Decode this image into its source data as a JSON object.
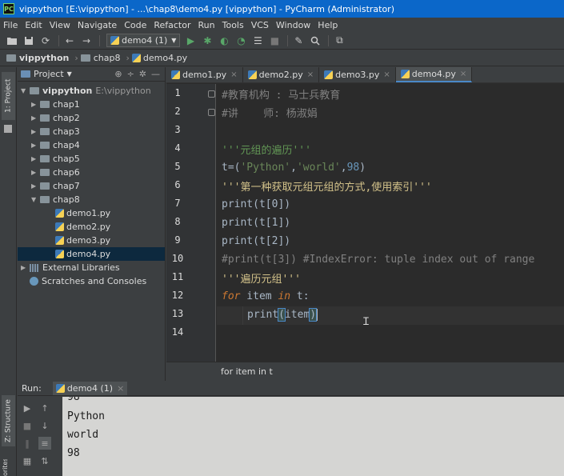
{
  "window": {
    "title": "vippython [E:\\vippython] - ...\\chap8\\demo4.py [vippython] - PyCharm (Administrator)",
    "app_icon_label": "PC"
  },
  "menu": [
    "File",
    "Edit",
    "View",
    "Navigate",
    "Code",
    "Refactor",
    "Run",
    "Tools",
    "VCS",
    "Window",
    "Help"
  ],
  "toolbar": {
    "run_config": "demo4 (1)"
  },
  "breadcrumb": [
    "vippython",
    "chap8",
    "demo4.py"
  ],
  "project_panel": {
    "header": "Project",
    "root": {
      "name": "vippython",
      "path": "E:\\vippython"
    },
    "folders": [
      "chap1",
      "chap2",
      "chap3",
      "chap4",
      "chap5",
      "chap6",
      "chap7",
      "chap8"
    ],
    "files": [
      "demo1.py",
      "demo2.py",
      "demo3.py",
      "demo4.py"
    ],
    "selected_file": "demo4.py",
    "external_libraries": "External Libraries",
    "scratches": "Scratches and Consoles",
    "side_tab": "1: Project"
  },
  "editor": {
    "tabs": [
      {
        "label": "demo1.py",
        "active": false
      },
      {
        "label": "demo2.py",
        "active": false
      },
      {
        "label": "demo3.py",
        "active": false
      },
      {
        "label": "demo4.py",
        "active": true
      }
    ],
    "line_numbers": [
      "1",
      "2",
      "3",
      "4",
      "5",
      "6",
      "7",
      "8",
      "9",
      "10",
      "11",
      "12",
      "13",
      "14"
    ],
    "code": {
      "l1": "#教育机构 : 马士兵教育",
      "l2": "#讲    师: 杨淑娟",
      "l4": "'''元组的遍历'''",
      "l5_a": "t=(",
      "l5_s1": "'Python'",
      "l5_c": ",",
      "l5_s2": "'world'",
      "l5_c2": ",",
      "l5_n": "98",
      "l5_b": ")",
      "l6": "'''第一种获取元组元组的方式,使用索引'''",
      "l7": "print(t[0])",
      "l8": "print(t[1])",
      "l9": "print(t[2])",
      "l10": "#print(t[3]) #IndexError: tuple index out of range",
      "l11": "'''遍历元组'''",
      "l12_kw1": "for",
      "l12_mid": " item ",
      "l12_kw2": "in",
      "l12_end": " t:",
      "l13_fn": "print",
      "l13_open": "(",
      "l13_arg": "item",
      "l13_close": ")"
    },
    "status_breadcrumb": "for item in t"
  },
  "run_panel": {
    "label": "Run:",
    "tab": "demo4 (1)",
    "side_tab_1": "Z: Structure",
    "side_tab_2": "orites",
    "output": [
      "98",
      "Python",
      "world",
      "98"
    ]
  },
  "colors": {
    "titlebar": "#0b67c9",
    "editor_bg": "#2b2b2b",
    "console_bg": "#d5d5d3",
    "selection": "#0d293e",
    "docstring": "#629755",
    "keyword": "#cc7832"
  }
}
